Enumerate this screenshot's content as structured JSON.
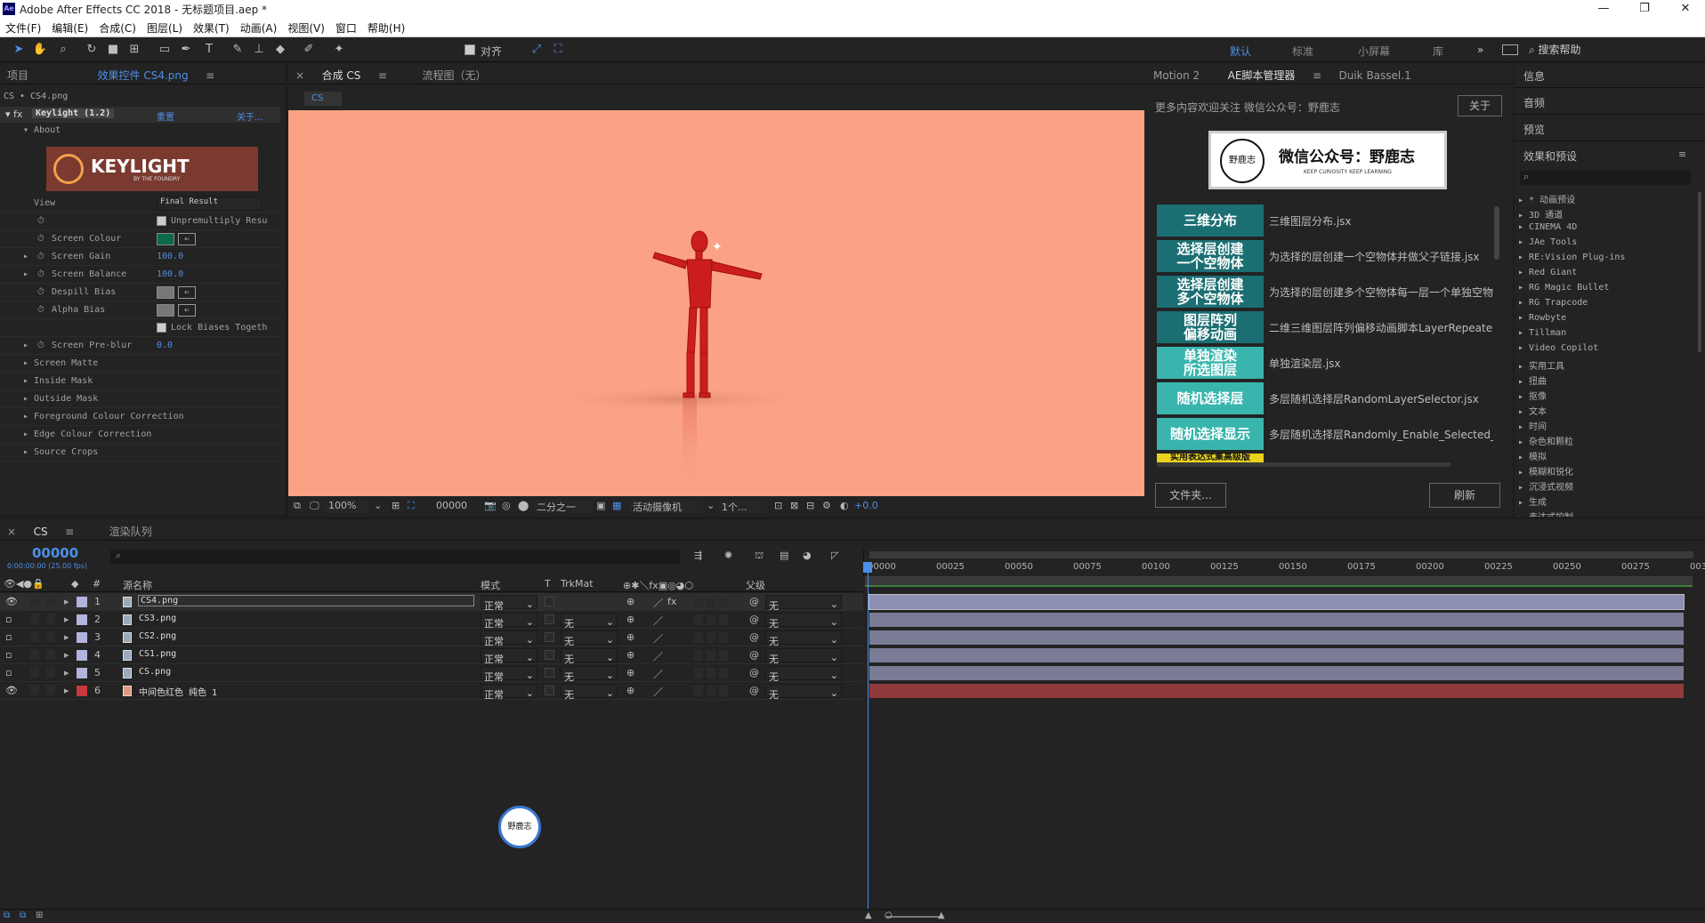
{
  "app": {
    "title": "Adobe After Effects CC 2018 - 无标题项目.aep *",
    "icon": "Ae"
  },
  "menu": [
    "文件(F)",
    "编辑(E)",
    "合成(C)",
    "图层(L)",
    "效果(T)",
    "动画(A)",
    "视图(V)",
    "窗口",
    "帮助(H)"
  ],
  "toolbar": {
    "snap_label": "对齐",
    "workspaces": [
      "默认",
      "标准",
      "小屏幕",
      "库"
    ],
    "active_workspace": "默认",
    "search_help": "搜索帮助"
  },
  "left_panel": {
    "tabs": [
      "项目",
      "效果控件 CS4.png"
    ],
    "breadcrumb": "CS • CS4.png",
    "effect": {
      "name": "Keylight (1.2)",
      "reset": "重置",
      "about": "关于...",
      "about_label": "About",
      "logo_text": "KEYLIGHT",
      "logo_sub": "BY THE FOUNDRY"
    },
    "props": [
      {
        "label": "View",
        "value": "Final Result"
      },
      {
        "label": "Unpremultiply Resu"
      },
      {
        "label": "Screen Colour"
      },
      {
        "label": "Screen Gain",
        "value": "100.0"
      },
      {
        "label": "Screen Balance",
        "value": "100.0"
      },
      {
        "label": "Despill Bias"
      },
      {
        "label": "Alpha Bias"
      },
      {
        "label": "Lock Biases Togeth"
      },
      {
        "label": "Screen Pre-blur",
        "value": "0.0"
      },
      {
        "label": "Screen Matte"
      },
      {
        "label": "Inside Mask"
      },
      {
        "label": "Outside Mask"
      },
      {
        "label": "Foreground Colour Correction"
      },
      {
        "label": "Edge Colour Correction"
      },
      {
        "label": "Source Crops"
      }
    ]
  },
  "comp_panel": {
    "tab": "合成 CS",
    "flow_tab": "流程图（无）",
    "subtab": "CS",
    "zoom": "100%",
    "timecode": "00000",
    "resolution": "二分之一",
    "camera": "活动摄像机",
    "views": "1个...",
    "exposure": "+0.0",
    "bg_color": "#fba284"
  },
  "scripts_panel": {
    "tabs": [
      "Motion 2",
      "AE脚本管理器",
      "Duik Bassel.1"
    ],
    "notice": "更多内容欢迎关注 微信公众号：野鹿志",
    "about_button": "关于",
    "banner_title": "微信公众号：野鹿志",
    "banner_sub": "KEEP CURIOSITY KEEP LEARNING",
    "logo_text": "野鹿志",
    "scripts": [
      {
        "label": "三维分布",
        "desc": "三维图层分布.jsx",
        "color": "#1b6f73"
      },
      {
        "label": "选择层创建\n一个空物体",
        "desc": "为选择的层创建一个空物体并做父子链接.jsx",
        "color": "#1b6f73"
      },
      {
        "label": "选择层创建\n多个空物体",
        "desc": "为选择的层创建多个空物体每一层一个单独空物体",
        "color": "#1b6f73"
      },
      {
        "label": "图层阵列\n偏移动画",
        "desc": "二维三维图层阵列偏移动画脚本LayerRepeater",
        "color": "#1b6f73"
      },
      {
        "label": "单独渲染\n所选图层",
        "desc": "单独渲染层.jsx",
        "color": "#39b5ad"
      },
      {
        "label": "随机选择层",
        "desc": "多层随机选择层RandomLayerSelector.jsx",
        "color": "#39b5ad"
      },
      {
        "label": "随机选择显示",
        "desc": "多层随机选择层Randomly_Enable_Selected_Layers",
        "color": "#39b5ad"
      },
      {
        "label": "实用表达式集高级版",
        "desc": "",
        "color": "#e8d21c"
      }
    ],
    "folder_button": "文件夹...",
    "refresh_button": "刷新"
  },
  "right_panel": {
    "items": [
      "信息",
      "音频",
      "预览",
      "效果和预设"
    ],
    "effects": [
      "* 动画预设",
      "3D 通道",
      "CINEMA 4D",
      "JAe Tools",
      "RE:Vision Plug-ins",
      "Red Giant",
      "RG Magic Bullet",
      "RG Trapcode",
      "Rowbyte",
      "Tillman",
      "Video Copilot",
      "实用工具",
      "扭曲",
      "抠像",
      "文本",
      "时间",
      "杂色和颗粒",
      "模拟",
      "模糊和锐化",
      "沉浸式视频",
      "生成",
      "表达式控制"
    ]
  },
  "timeline": {
    "tabs": [
      "CS",
      "渲染队列"
    ],
    "timecode": "00000",
    "timecode_sub": "0:00:00:00 (25.00 fps)",
    "cols": {
      "source": "源名称",
      "mode": "模式",
      "t": "T",
      "trkmat": "TrkMat",
      "parent": "父级"
    },
    "ruler": [
      "00000",
      "00025",
      "00050",
      "00075",
      "00100",
      "00125",
      "00150",
      "00175",
      "00200",
      "00225",
      "00250",
      "00275",
      "003"
    ],
    "layers": [
      {
        "num": "1",
        "name": "CS4.png",
        "mode": "正常",
        "trk": "",
        "parent": "无",
        "color": "#b1b4dd",
        "bar": "#8d8fb5",
        "eye": true
      },
      {
        "num": "2",
        "name": "CS3.png",
        "mode": "正常",
        "trk": "无",
        "parent": "无",
        "color": "#b1b4dd",
        "bar": "#7a7c95",
        "eye": false
      },
      {
        "num": "3",
        "name": "CS2.png",
        "mode": "正常",
        "trk": "无",
        "parent": "无",
        "color": "#b1b4dd",
        "bar": "#7a7c95",
        "eye": false
      },
      {
        "num": "4",
        "name": "CS1.png",
        "mode": "正常",
        "trk": "无",
        "parent": "无",
        "color": "#b1b4dd",
        "bar": "#7a7c95",
        "eye": false
      },
      {
        "num": "5",
        "name": "CS.png",
        "mode": "正常",
        "trk": "无",
        "parent": "无",
        "color": "#b1b4dd",
        "bar": "#7a7c95",
        "eye": false
      },
      {
        "num": "6",
        "name": "中间色红色 纯色 1",
        "mode": "正常",
        "trk": "无",
        "parent": "无",
        "color": "#c7393b",
        "bar": "#8f3a3b",
        "eye": true
      }
    ]
  }
}
